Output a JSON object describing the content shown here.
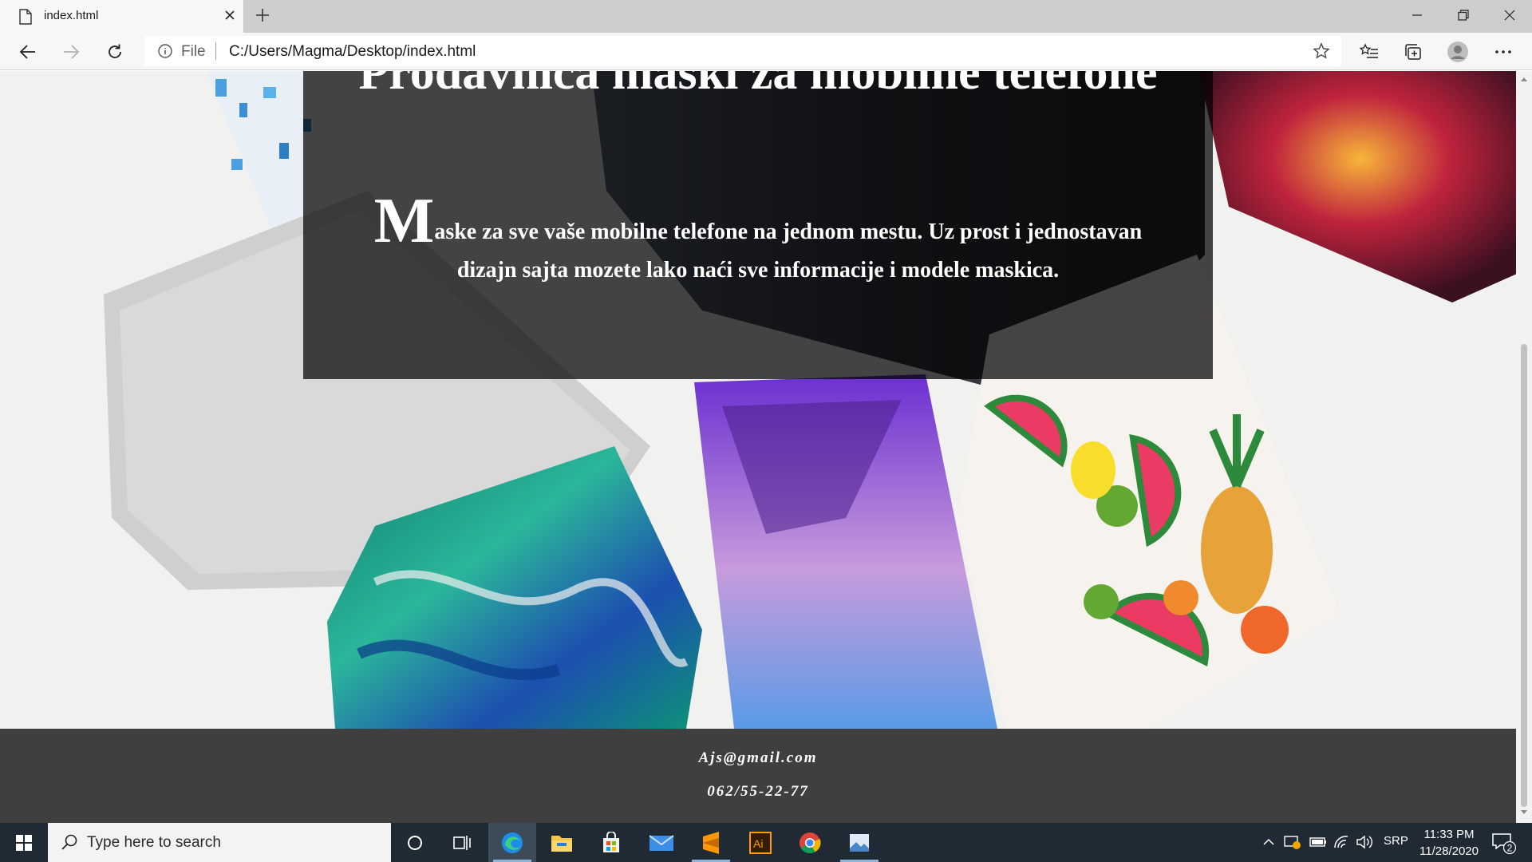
{
  "browser": {
    "tab_title": "index.html",
    "address_scheme": "File",
    "address_url": "C:/Users/Magma/Desktop/index.html"
  },
  "page": {
    "heading": "Prodavnica maski za mobilne telefone",
    "lead_initial": "M",
    "lead_text": "aske za sve vaše mobilne telefone na jednom mestu. Uz prost i jednostavan dizajn sajta mozete lako naći sve informacije i modele maskica.",
    "footer": {
      "email": "Ajs@gmail.com",
      "phone": "062/55-22-77"
    }
  },
  "taskbar": {
    "search_placeholder": "Type here to search",
    "language": "SRP",
    "time": "11:33 PM",
    "date": "11/28/2020",
    "notification_count": "2",
    "apps": [
      "cortana-icon",
      "task-view-icon",
      "edge-icon",
      "file-explorer-icon",
      "store-icon",
      "mail-icon",
      "sublime-text-icon",
      "illustrator-icon",
      "chrome-icon",
      "photos-icon"
    ]
  },
  "colors": {
    "overlay": "#000000b8",
    "footer_bg": "#3f3f3f",
    "taskbar_bg": "#1f2a35",
    "chrome_bg": "#f7f7f7"
  }
}
